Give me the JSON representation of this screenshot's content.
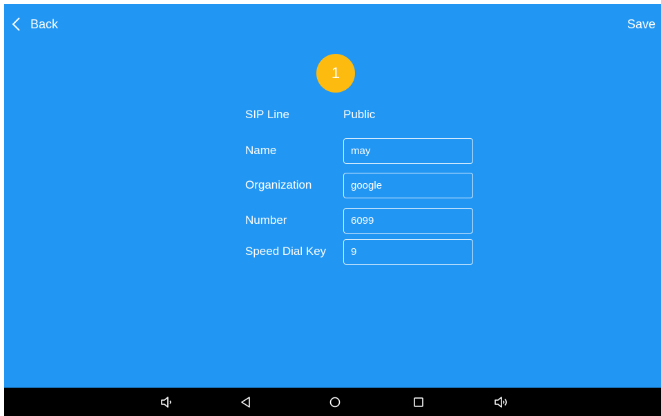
{
  "header": {
    "back_label": "Back",
    "save_label": "Save"
  },
  "contact": {
    "avatar_text": "1"
  },
  "form": {
    "sip_line": {
      "label": "SIP Line",
      "value": "Public"
    },
    "name": {
      "label": "Name",
      "value": "may"
    },
    "organization": {
      "label": "Organization",
      "value": "google"
    },
    "number": {
      "label": "Number",
      "value": "6099"
    },
    "speed_dial": {
      "label": "Speed Dial Key",
      "value": "9"
    }
  },
  "colors": {
    "background": "#2196f3",
    "avatar": "#fdbb10",
    "navbar": "#000000"
  },
  "navbar": {
    "icons": [
      "volume-down-icon",
      "back-triangle-icon",
      "home-circle-icon",
      "recents-square-icon",
      "volume-up-icon"
    ]
  }
}
